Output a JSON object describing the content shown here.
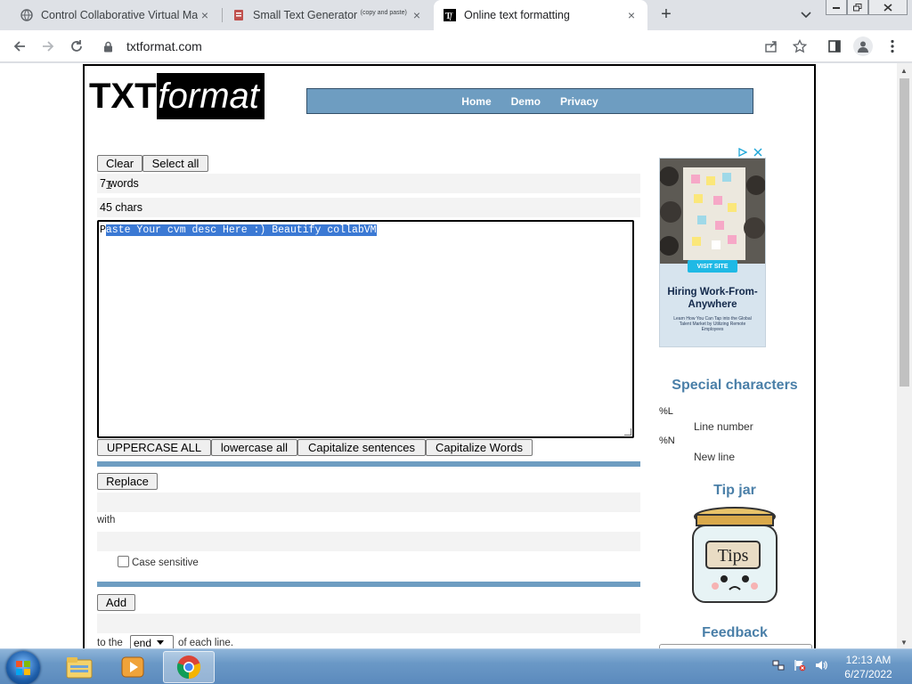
{
  "browser": {
    "tabs": [
      {
        "title": "Control Collaborative Virtual Ma",
        "active": false
      },
      {
        "title": "Small Text Generator",
        "title_sup": "(copy and paste)",
        "active": false
      },
      {
        "title": "Online text formatting",
        "active": true
      }
    ],
    "url": "txtformat.com",
    "new_tab_symbol": "+",
    "close_symbol": "×"
  },
  "site": {
    "logo_part1": "TXT",
    "logo_part2": "format",
    "nav": [
      "Home",
      "Demo",
      "Privacy"
    ]
  },
  "editor": {
    "clear_label": "Clear",
    "select_all_label": "Select all",
    "word_count": "7 words",
    "char_count": "45 chars",
    "text_first_char": "P",
    "text_selected": "aste Your cvm desc Here :) Beautify collabVM",
    "uppercase_label": "UPPERCASE ALL",
    "lowercase_label": "lowercase all",
    "capitalize_sentences_label": "Capitalize sentences",
    "capitalize_words_label": "Capitalize Words"
  },
  "replace": {
    "button_label": "Replace",
    "with_label": "with",
    "case_sensitive_label": "Case sensitive"
  },
  "add": {
    "button_label": "Add",
    "to_the_label": "to the",
    "position_value": "end",
    "each_line_label": "of each line."
  },
  "ad": {
    "visit_label": "VISIT SITE",
    "headline": "Hiring Work-From-Anywhere",
    "subtext": "Learn How You Can Tap into the Global Talent Market by Utilizing Remote Employees"
  },
  "sidebar": {
    "special_heading": "Special characters",
    "special_chars": [
      {
        "code": "%L",
        "desc": "Line number"
      },
      {
        "code": "%N",
        "desc": "New line"
      }
    ],
    "tip_heading": "Tip jar",
    "tip_jar_text": "Tips",
    "feedback_heading": "Feedback"
  },
  "taskbar": {
    "time": "12:13 AM",
    "date": "6/27/2022"
  },
  "colors": {
    "accent_blue": "#6e9dc1",
    "heading_blue": "#4a7fa8",
    "selection": "#3b79d4"
  }
}
